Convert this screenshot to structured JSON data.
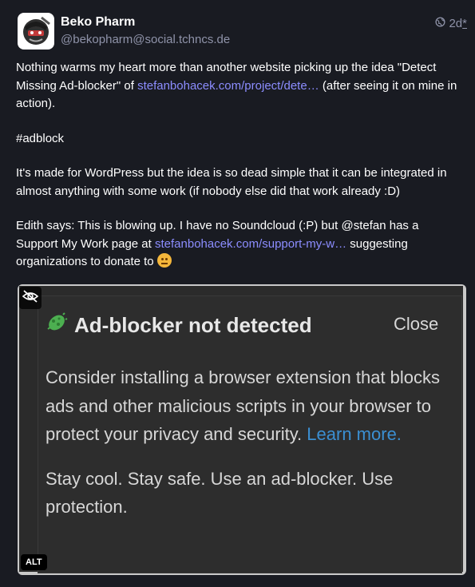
{
  "author": {
    "display_name": "Beko Pharm",
    "handle": "@bekopharm@social.tchncs.de"
  },
  "meta": {
    "visibility_icon": "globe-icon",
    "timestamp": "2d",
    "edited_marker": "*"
  },
  "post": {
    "p1_before": "Nothing warms my heart more than another website picking up the idea \"Detect Missing Ad-blocker\" of ",
    "p1_link": "stefanbohacek.com/project/dete…",
    "p1_after": " (after seeing it on mine in action).",
    "hashtag": "#adblock",
    "p3": "It's made for WordPress but the idea is so dead simple that it can be integrated in almost anything with some work (if nobody else did that work already :D)",
    "p4_before": "Edith says: This is blowing up. I have no Soundcloud (:P) but ",
    "p4_mention": "@stefan",
    "p4_mid": "  has a Support My Work page at ",
    "p4_link": "stefanbohacek.com/support-my-w…",
    "p4_after": " suggesting organizations to donate to ",
    "emoji": "smiling-face-emoji"
  },
  "media": {
    "title": "Ad-blocker not detected",
    "close_label": "Close",
    "body_text": "Consider installing a browser extension that blocks ads and other malicious scripts in your browser to protect your privacy and security. ",
    "learn_more": "Learn more.",
    "tagline": "Stay cool. Stay safe. Use an ad-blocker. Use protection.",
    "alt_badge": "ALT",
    "hide_icon": "eye-slash-icon",
    "virus_icon": "virus-icon"
  }
}
